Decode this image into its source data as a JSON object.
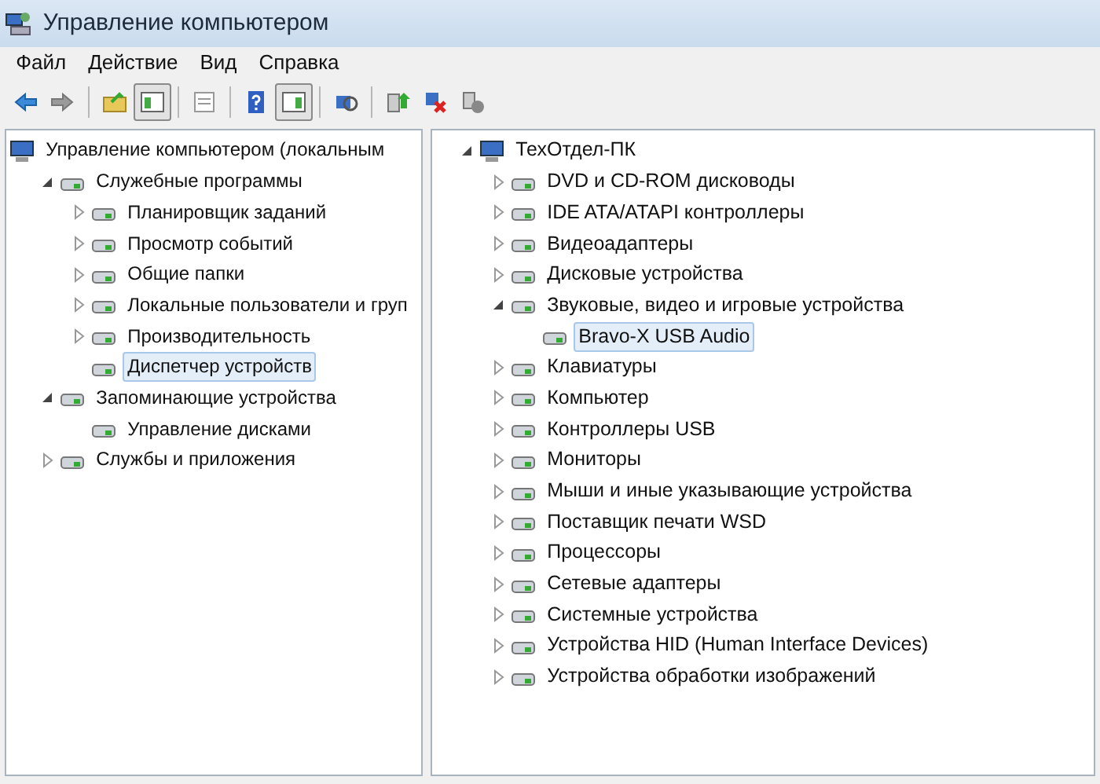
{
  "window": {
    "title": "Управление компьютером"
  },
  "menu": [
    "Файл",
    "Действие",
    "Вид",
    "Справка"
  ],
  "toolbar": [
    [
      {
        "kind": "back",
        "pressed": false
      },
      {
        "kind": "forward",
        "pressed": false
      }
    ],
    [
      {
        "kind": "up",
        "pressed": false
      },
      {
        "kind": "tree",
        "pressed": true
      }
    ],
    [
      {
        "kind": "properties",
        "pressed": false
      }
    ],
    [
      {
        "kind": "help",
        "pressed": false
      },
      {
        "kind": "actions",
        "pressed": true
      }
    ],
    [
      {
        "kind": "scan",
        "pressed": false
      }
    ],
    [
      {
        "kind": "update",
        "pressed": false
      },
      {
        "kind": "uninstall",
        "pressed": false
      },
      {
        "kind": "disable",
        "pressed": false
      }
    ]
  ],
  "left_tree": [
    {
      "label": "Управление компьютером (локальным",
      "selected": false,
      "children": [
        {
          "label": "Служебные программы",
          "expanded": true,
          "selected": false,
          "children": [
            {
              "label": "Планировщик заданий",
              "expanded": false,
              "selected": false
            },
            {
              "label": "Просмотр событий",
              "expanded": false,
              "selected": false
            },
            {
              "label": "Общие папки",
              "expanded": false,
              "selected": false
            },
            {
              "label": "Локальные пользователи и груп",
              "expanded": false,
              "selected": false
            },
            {
              "label": "Производительность",
              "expanded": false,
              "selected": false
            },
            {
              "label": "Диспетчер устройств",
              "selected": true
            }
          ]
        },
        {
          "label": "Запоминающие устройства",
          "expanded": true,
          "selected": false,
          "children": [
            {
              "label": "Управление дисками",
              "selected": false
            }
          ]
        },
        {
          "label": "Службы и приложения",
          "expanded": false,
          "selected": false
        }
      ]
    }
  ],
  "device_tree": [
    {
      "label": "ТехОтдел-ПК",
      "expanded": true,
      "selected": false,
      "children": [
        {
          "label": "DVD и CD-ROM дисководы",
          "expanded": false,
          "selected": false
        },
        {
          "label": "IDE ATA/ATAPI контроллеры",
          "expanded": false,
          "selected": false
        },
        {
          "label": "Видеоадаптеры",
          "expanded": false,
          "selected": false
        },
        {
          "label": "Дисковые устройства",
          "expanded": false,
          "selected": false
        },
        {
          "label": "Звуковые, видео и игровые устройства",
          "expanded": true,
          "selected": false,
          "children": [
            {
              "label": "Bravo-X USB Audio",
              "selected": true
            }
          ]
        },
        {
          "label": "Клавиатуры",
          "expanded": false,
          "selected": false
        },
        {
          "label": "Компьютер",
          "expanded": false,
          "selected": false
        },
        {
          "label": "Контроллеры USB",
          "expanded": false,
          "selected": false
        },
        {
          "label": "Мониторы",
          "expanded": false,
          "selected": false
        },
        {
          "label": "Мыши и иные указывающие устройства",
          "expanded": false,
          "selected": false
        },
        {
          "label": "Поставщик печати WSD",
          "expanded": false,
          "selected": false
        },
        {
          "label": "Процессоры",
          "expanded": false,
          "selected": false
        },
        {
          "label": "Сетевые адаптеры",
          "expanded": false,
          "selected": false
        },
        {
          "label": "Системные устройства",
          "expanded": false,
          "selected": false
        },
        {
          "label": "Устройства HID (Human Interface Devices)",
          "expanded": false,
          "selected": false
        },
        {
          "label": "Устройства обработки изображений",
          "expanded": false,
          "selected": false
        }
      ]
    }
  ]
}
